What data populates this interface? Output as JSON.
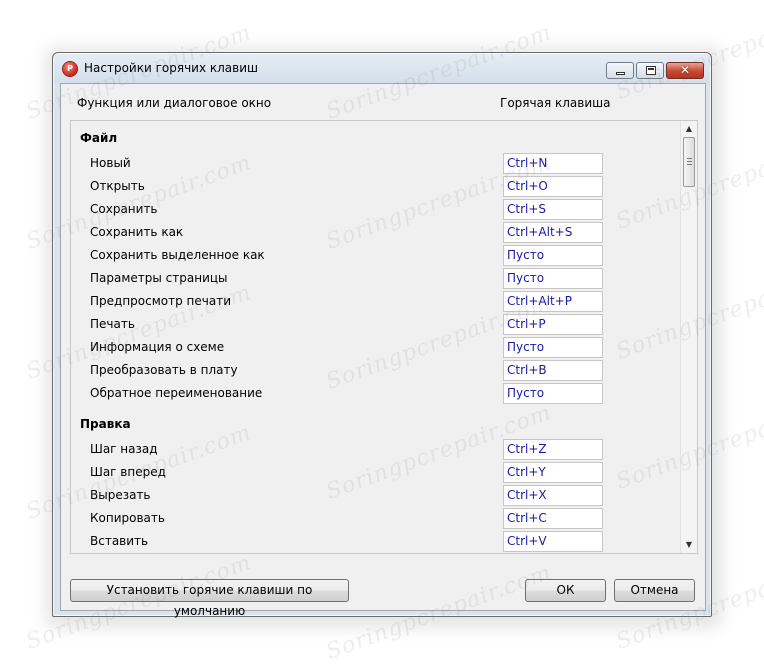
{
  "window": {
    "title": "Настройки горячих клавиш",
    "close_glyph": "✕"
  },
  "columns": {
    "function": "Функция или диалоговое окно",
    "hotkey": "Горячая клавиша"
  },
  "sections": [
    {
      "title": "Файл",
      "items": [
        {
          "label": "Новый",
          "hotkey": "Ctrl+N"
        },
        {
          "label": "Открыть",
          "hotkey": "Ctrl+O"
        },
        {
          "label": "Сохранить",
          "hotkey": "Ctrl+S"
        },
        {
          "label": "Сохранить как",
          "hotkey": "Ctrl+Alt+S"
        },
        {
          "label": "Сохранить выделенное как",
          "hotkey": "Пусто"
        },
        {
          "label": "Параметры страницы",
          "hotkey": "Пусто"
        },
        {
          "label": "Предпросмотр печати",
          "hotkey": "Ctrl+Alt+P"
        },
        {
          "label": "Печать",
          "hotkey": "Ctrl+P"
        },
        {
          "label": "Информация о схеме",
          "hotkey": "Пусто"
        },
        {
          "label": "Преобразовать в плату",
          "hotkey": "Ctrl+B"
        },
        {
          "label": "Обратное переименование",
          "hotkey": "Пусто"
        }
      ]
    },
    {
      "title": "Правка",
      "items": [
        {
          "label": "Шаг назад",
          "hotkey": "Ctrl+Z"
        },
        {
          "label": "Шаг вперед",
          "hotkey": "Ctrl+Y"
        },
        {
          "label": "Вырезать",
          "hotkey": "Ctrl+X"
        },
        {
          "label": "Копировать",
          "hotkey": "Ctrl+C"
        },
        {
          "label": "Вставить",
          "hotkey": "Ctrl+V"
        }
      ]
    }
  ],
  "buttons": {
    "default": "Установить горячие клавиши по умолчанию",
    "ok": "ОК",
    "cancel": "Отмена"
  },
  "watermark": "Soringpcrepair.com",
  "icons": {
    "app": "app-logo-icon",
    "minimize": "minimize-icon",
    "maximize": "maximize-icon",
    "close": "close-icon",
    "scroll_up": "scroll-up-arrow-icon",
    "scroll_down": "scroll-down-arrow-icon"
  },
  "scroll": {
    "position_fraction": 0.0
  }
}
